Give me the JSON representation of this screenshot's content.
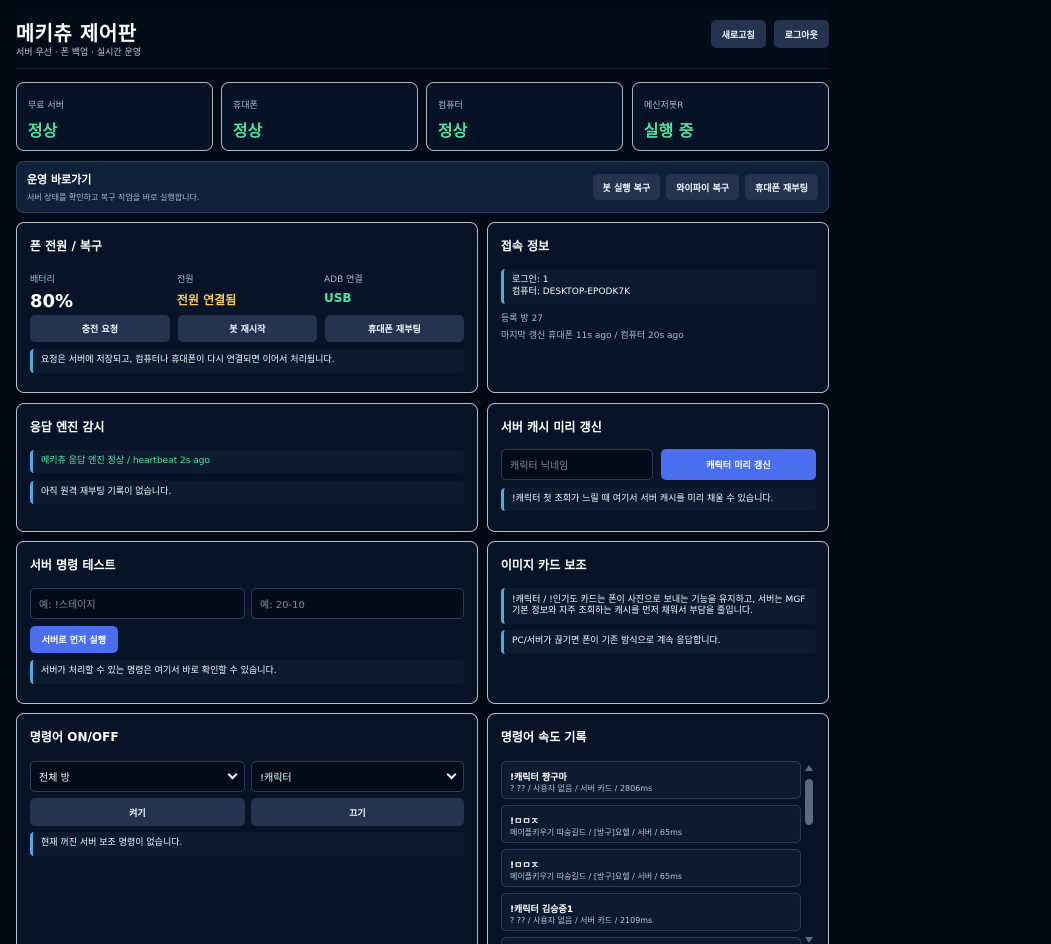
{
  "header": {
    "title": "메키츄 제어판",
    "subtitle": "서버 우선 · 폰 백업 · 실시간 운영",
    "refresh_label": "새로고침",
    "logout_label": "로그아웃"
  },
  "status_cards": [
    {
      "label": "무료 서버",
      "value": "정상"
    },
    {
      "label": "휴대폰",
      "value": "정상"
    },
    {
      "label": "컴퓨터",
      "value": "정상"
    },
    {
      "label": "메신저봇R",
      "value": "실행 중"
    }
  ],
  "quick": {
    "title": "운영 바로가기",
    "desc": "서버 상태를 확인하고 복구 작업을 바로 실행합니다.",
    "buttons": [
      "봇 실행 복구",
      "와이파이 복구",
      "휴대폰 재부팅"
    ]
  },
  "phone_power": {
    "title": "폰 전원 / 복구",
    "battery_label": "배터리",
    "battery_value": "80%",
    "power_label": "전원",
    "power_value": "전원 연결됨",
    "adb_label": "ADB 연결",
    "adb_value": "USB",
    "buttons": [
      "충전 요청",
      "봇 재시작",
      "휴대폰 재부팅"
    ],
    "note": "요청은 서버에 저장되고, 컴퓨터나 휴대폰이 다시 연결되면 이어서 처리됩니다."
  },
  "connection": {
    "title": "접속 정보",
    "login": "로그인: 1",
    "computer": "컴퓨터: DESKTOP-EPODK7K",
    "rooms": "등록 방 27",
    "last_update": "마지막 갱신 휴대폰 11s ago / 컴퓨터 20s ago"
  },
  "engine": {
    "title": "응답 엔진 감시",
    "status": "메키츄 응답 엔진 정상 / heartbeat 2s ago",
    "reboot_note": "아직 원격 재부팅 기록이 없습니다."
  },
  "cache": {
    "title": "서버 캐시 미리 갱신",
    "placeholder": "캐릭터 닉네임",
    "button": "캐릭터 미리 갱신",
    "note": "!캐릭터 첫 조회가 느릴 때 여기서 서버 캐시를 미리 채울 수 있습니다."
  },
  "cmd_test": {
    "title": "서버 명령 테스트",
    "placeholder1": "예: !스테이지",
    "placeholder2": "예: 20-10",
    "button": "서버로 먼저 실행",
    "note": "서버가 처리할 수 있는 명령은 여기서 바로 확인할 수 있습니다."
  },
  "image_card": {
    "title": "이미지 카드 보조",
    "note1_line1": "!캐릭터 / !인기도 카드는 폰이 사진으로 보내는 기능을 유지하고, 서버는 MGF",
    "note1_line2": "기본 정보와 자주 조회하는 캐시를 먼저 채워서 부담을 줄입니다.",
    "note2": "PC/서버가 끊기면 폰이 기존 방식으로 계속 응답합니다."
  },
  "toggle": {
    "title": "명령어 ON/OFF",
    "room_select": "전체 방",
    "cmd_select": "!캐릭터",
    "on_label": "켜기",
    "off_label": "끄기",
    "note": "현재 꺼진 서버 보조 명령이 없습니다."
  },
  "speed_log": {
    "title": "명령어 속도 기록",
    "entries": [
      {
        "title": "!캐릭터 짱구마",
        "sub": "? ?? / 사용자 없음 / 서버 카드 / 2806ms"
      },
      {
        "title": "!ㅁㅁㅈ",
        "sub": "메이플키우기 따숭길드 / [방구]요헬 / 서버 / 65ms"
      },
      {
        "title": "!ㅁㅁㅈ",
        "sub": "메이플키우기 따숭길드 / [방구]요헬 / 서버 / 65ms"
      },
      {
        "title": "!캐릭터 김승중1",
        "sub": "? ?? / 사용자 없음 / 서버 카드 / 2109ms"
      }
    ]
  },
  "colors": {
    "accent": "#4b6ef0",
    "ok": "#4ee3a0",
    "warn": "#f5c95a"
  }
}
